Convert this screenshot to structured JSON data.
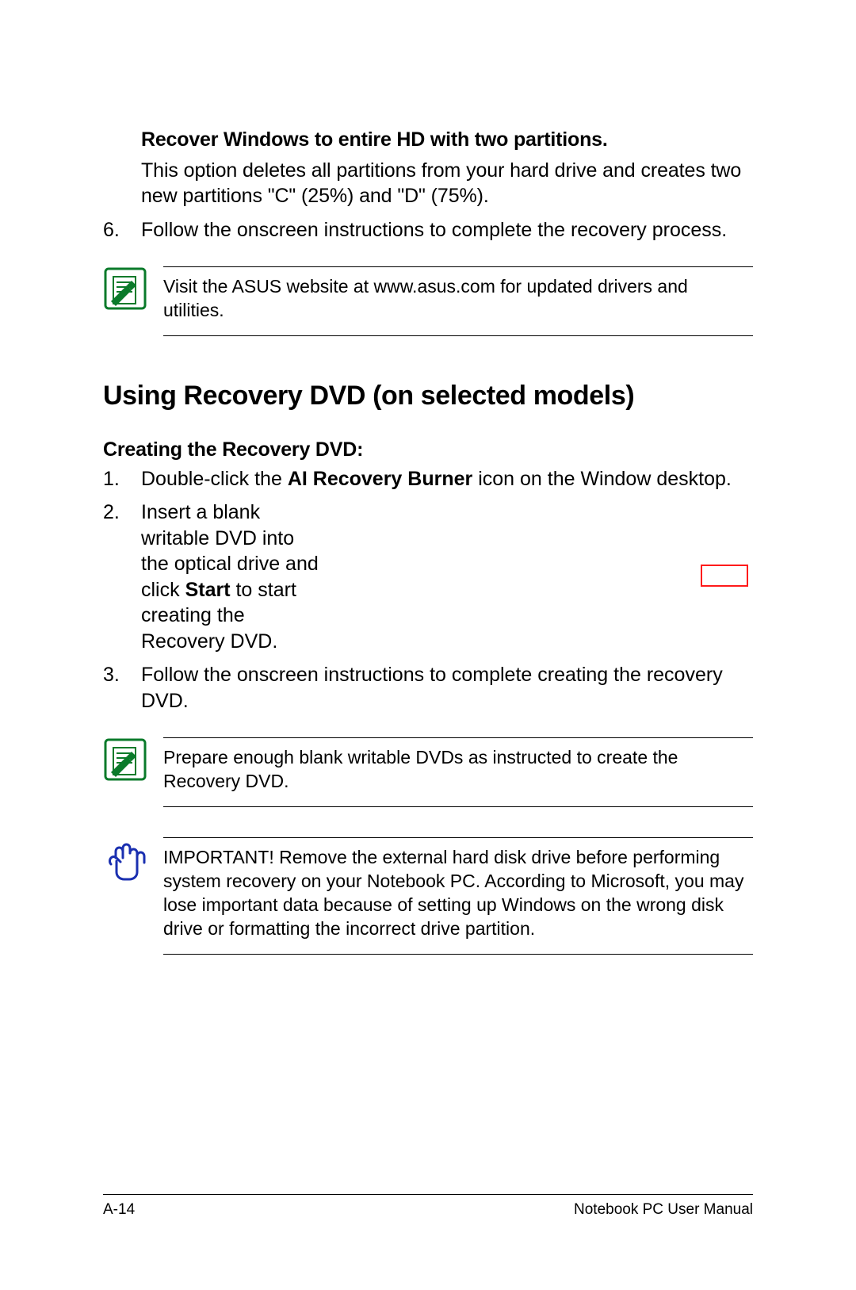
{
  "section1": {
    "heading": "Recover Windows to entire HD with two partitions.",
    "desc": "This option deletes all partitions from your hard drive and creates two new partitions \"C\" (25%) and \"D\" (75%)."
  },
  "step6": {
    "num": "6.",
    "text": "Follow the onscreen instructions to complete the recovery process."
  },
  "note1": "Visit the ASUS website at www.asus.com for updated drivers and utilities.",
  "section2": {
    "heading": "Using Recovery DVD (on selected models)",
    "sub": "Creating the Recovery DVD:"
  },
  "step1": {
    "num": "1.",
    "pre": "Double-click the ",
    "bold": "AI Recovery Burner",
    "post": " icon on the Window desktop."
  },
  "step2": {
    "num": "2.",
    "pre": "Insert a blank writable DVD into the optical drive and click ",
    "bold": "Start",
    "post": " to start creating the Recovery DVD."
  },
  "step3": {
    "num": "3.",
    "text": "Follow the onscreen instructions to complete creating the recovery DVD."
  },
  "note2": "Prepare enough blank writable DVDs as instructed to create the Recovery DVD.",
  "important": "IMPORTANT! Remove the external hard disk drive before performing system recovery on your Notebook PC. According to Microsoft, you may lose important data because of setting up Windows on the wrong disk drive or formatting the incorrect drive partition.",
  "footer": {
    "page": "A-14",
    "title": "Notebook PC User Manual"
  }
}
